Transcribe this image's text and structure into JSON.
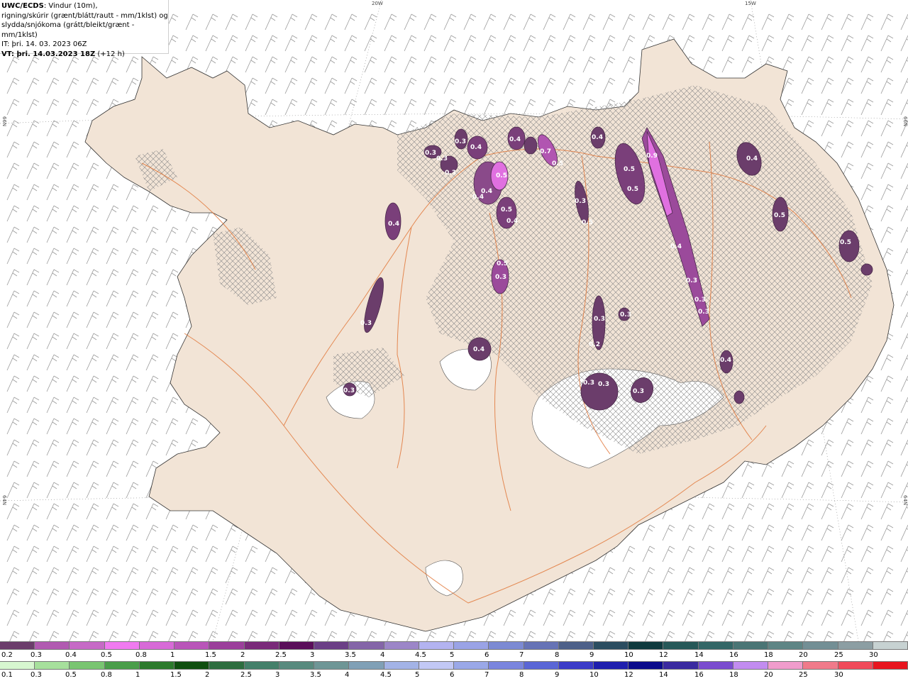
{
  "header": {
    "line1_bold": "UWC/ECDS",
    "line1_rest": ": Vindur (10m),",
    "line2": "rigning/skúrir (grænt/blátt/rautt - mm/1klst) og",
    "line3": "slydda/snjókoma (grátt/bleikt/grænt - mm/1klst)",
    "line4": "IT: þri. 14. 03. 2023 06Z",
    "line5_bold": "VT: þri. 14.03.2023 18Z",
    "line5_rest": " (+12 h)"
  },
  "grid_labels": {
    "lon_20w": "20W",
    "lon_15w": "15W",
    "lat_66_left": "66N",
    "lat_66_right": "66N",
    "lat_64_left": "64N",
    "lat_64_right": "64N"
  },
  "precip_labels": [
    {
      "text": "0.4"
    },
    {
      "text": "0.3"
    },
    {
      "text": "0.3"
    },
    {
      "text": "0.3"
    },
    {
      "text": "0.3"
    },
    {
      "text": "0.3"
    },
    {
      "text": "0.4"
    },
    {
      "text": "0.4"
    },
    {
      "text": "0.7"
    },
    {
      "text": "0.5"
    },
    {
      "text": "0.5"
    },
    {
      "text": "0.4"
    },
    {
      "text": "0.4"
    },
    {
      "text": "0.5"
    },
    {
      "text": "0.4"
    },
    {
      "text": "0.4"
    },
    {
      "text": "0.5"
    },
    {
      "text": "0.5"
    },
    {
      "text": "0.9"
    },
    {
      "text": "0.4"
    },
    {
      "text": "0.5"
    },
    {
      "text": "0.3"
    },
    {
      "text": "0.5"
    },
    {
      "text": "0.4"
    },
    {
      "text": "0.3"
    },
    {
      "text": "0.3"
    },
    {
      "text": "0.3"
    },
    {
      "text": "0.3"
    },
    {
      "text": "0.4"
    },
    {
      "text": "0.3"
    },
    {
      "text": "0.5"
    },
    {
      "text": "0.2"
    },
    {
      "text": "0.3"
    },
    {
      "text": "0.3"
    },
    {
      "text": "0.3"
    },
    {
      "text": "0.4"
    },
    {
      "text": "0.5"
    },
    {
      "text": "0.3"
    },
    {
      "text": "0.3"
    }
  ],
  "legend": {
    "snow_labels": [
      "0.2",
      "0.3",
      "0.4",
      "0.5",
      "0.8",
      "1",
      "1.5",
      "2",
      "2.5",
      "3",
      "3.5",
      "4",
      "4.5",
      "5",
      "6",
      "7",
      "8",
      "9",
      "10",
      "12",
      "14",
      "16",
      "18",
      "20",
      "25",
      "30"
    ],
    "snow_colors": [
      "#6b3d6b",
      "#b15ab1",
      "#c66ac6",
      "#f07af0",
      "#d76ad7",
      "#b955b9",
      "#9b3f9b",
      "#7a2a7a",
      "#5a0e5a",
      "#6b3f86",
      "#8465a8",
      "#9c86c8",
      "#b3b3f0",
      "#9aa3e6",
      "#7c8ad3",
      "#6673b6",
      "#4d6089",
      "#2b4d60",
      "#0f3a3e",
      "#265858",
      "#336666",
      "#4a7575",
      "#5e8585",
      "#738f95",
      "#8c9ea3",
      "#c7d2d2"
    ],
    "rain_labels": [
      "0.1",
      "0.3",
      "0.5",
      "0.8",
      "1",
      "1.5",
      "2",
      "2.5",
      "3",
      "3.5",
      "4",
      "4.5",
      "5",
      "6",
      "7",
      "8",
      "9",
      "10",
      "12",
      "14",
      "16",
      "18",
      "20",
      "25",
      "30"
    ],
    "rain_colors": [
      "#d7f7d0",
      "#a6e09c",
      "#79c571",
      "#4a9e4a",
      "#2c7a2c",
      "#0f4f0f",
      "#2d6d3f",
      "#44806a",
      "#588a7e",
      "#6e9696",
      "#80a0b6",
      "#a3b3e6",
      "#c2c8f5",
      "#9aa8e8",
      "#7a85de",
      "#5a66d6",
      "#3b3bc8",
      "#1f1fae",
      "#0b0b8c",
      "#3a2aa0",
      "#7a4ccf",
      "#c28cf0",
      "#f09ccc",
      "#f07a8a",
      "#f04a5a",
      "#e8141e"
    ]
  }
}
